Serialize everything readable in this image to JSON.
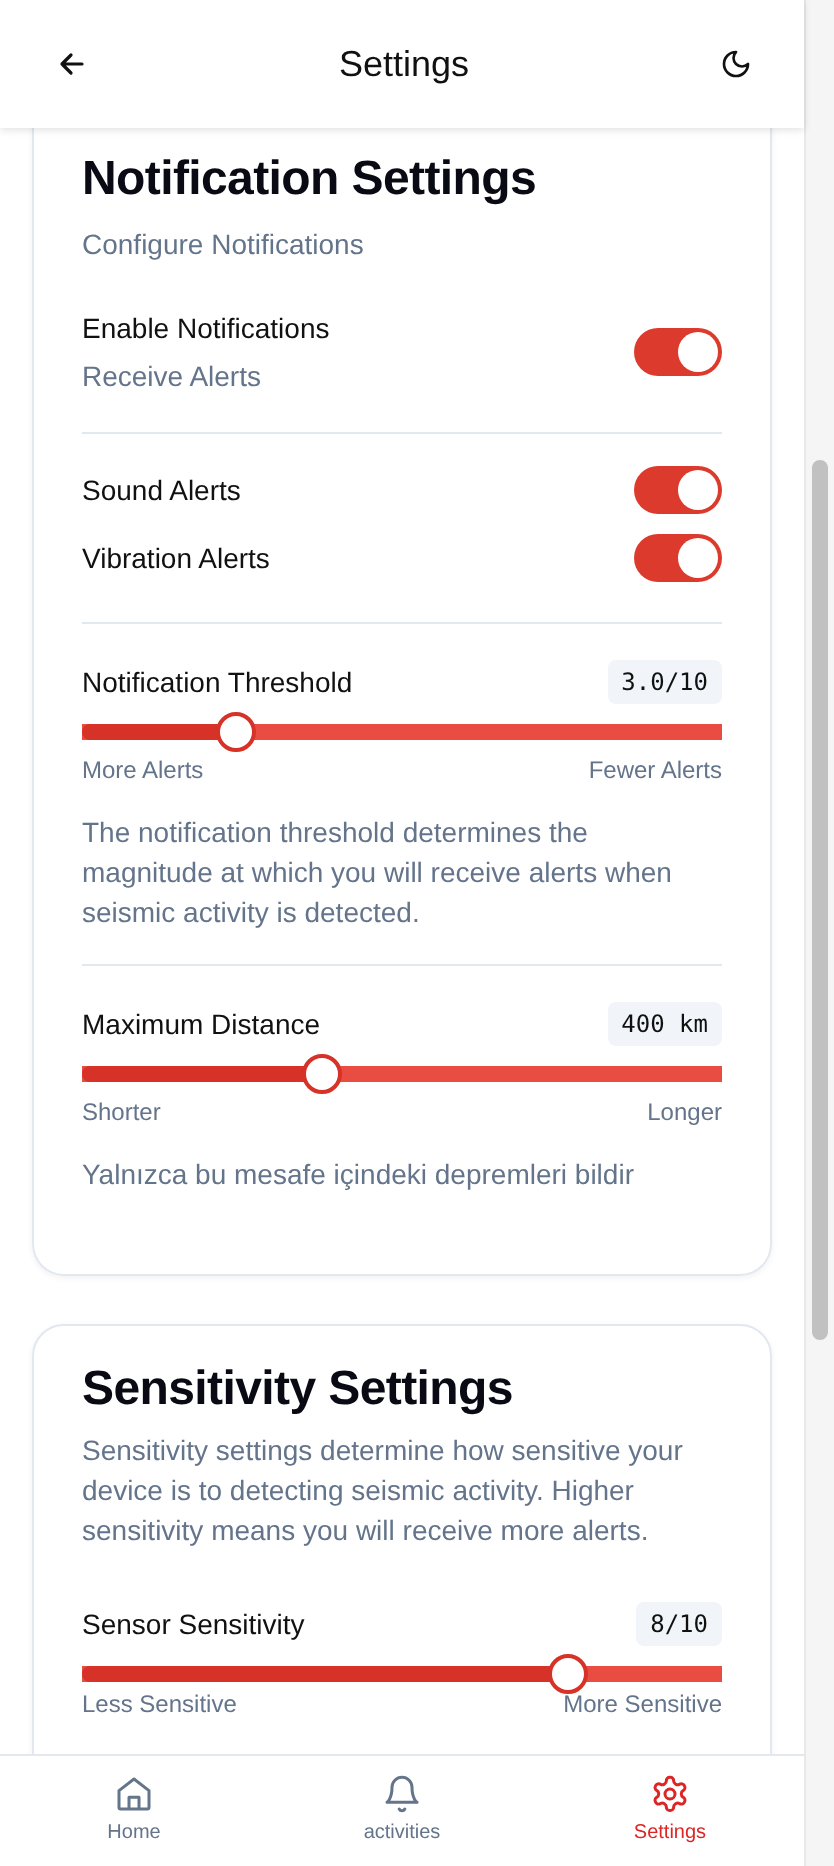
{
  "header": {
    "title": "Settings"
  },
  "notification_card": {
    "title": "Notification Settings",
    "subtitle": "Configure Notifications",
    "toggle_groups": [
      [
        {
          "label": "Enable Notifications",
          "hint": "Receive Alerts",
          "on": true
        }
      ],
      [
        {
          "label": "Sound Alerts",
          "on": true
        },
        {
          "label": "Vibration Alerts",
          "on": true
        }
      ]
    ],
    "sliders": [
      {
        "label": "Notification Threshold",
        "reading": "3.0/10",
        "level": 0.24,
        "min_label": "More Alerts",
        "max_label": "Fewer Alerts",
        "description": "The notification threshold determines the magnitude at which you will receive alerts when seismic activity is detected."
      },
      {
        "label": "Maximum Distance",
        "reading": "400 km",
        "level": 0.376,
        "min_label": "Shorter",
        "max_label": "Longer",
        "description": "Yalnızca bu mesafe içindeki depremleri bildir"
      }
    ]
  },
  "sensitivity_card": {
    "title": "Sensitivity Settings",
    "description": "Sensitivity settings determine how sensitive your device is to detecting seismic activity. Higher sensitivity means you will receive more alerts.",
    "sliders": [
      {
        "label": "Sensor Sensitivity",
        "reading": "8/10",
        "level": 0.76,
        "min_label": "Less Sensitive",
        "max_label": "More Sensitive"
      }
    ]
  },
  "bottom_nav": [
    {
      "kind": "home",
      "label": "Home",
      "selected": false
    },
    {
      "kind": "bell",
      "label": "activities",
      "selected": false
    },
    {
      "kind": "gear",
      "label": "Settings",
      "selected": true
    }
  ]
}
